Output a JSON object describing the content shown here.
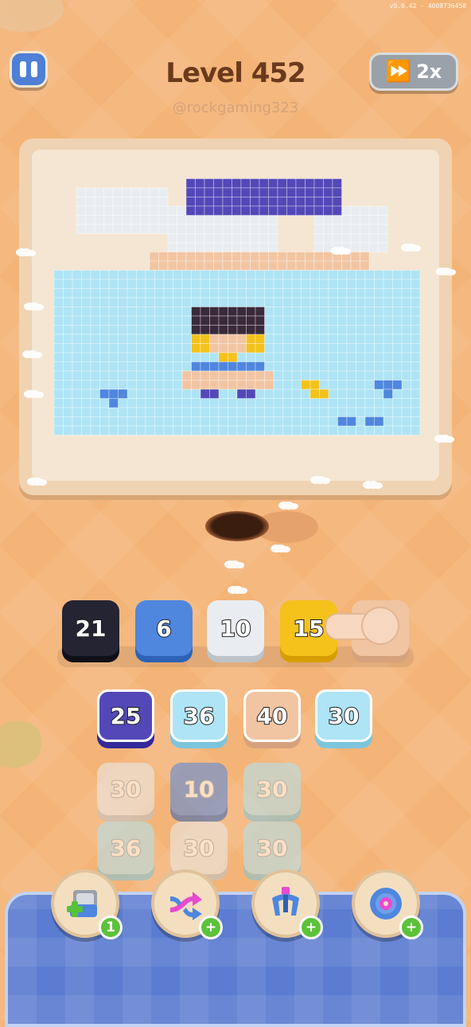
{
  "version_text": "v5.0.42 - 4008736458",
  "header": {
    "title": "Level 452",
    "watermark": "@rockgaming323",
    "speed_label": "2x"
  },
  "colors": {
    "navy": "#242432",
    "blue": "#4f86de",
    "white": "#e9edf1",
    "yellow": "#f5c21b",
    "peach": "#f2c5a2",
    "purple": "#5448b8",
    "light_blue": "#aee4f5",
    "dark_brown": "#3b2a3a"
  },
  "collector_slots": [
    {
      "count": "21",
      "color": "navy"
    },
    {
      "count": "6",
      "color": "blue"
    },
    {
      "count": "10",
      "color": "white"
    },
    {
      "count": "15",
      "color": "yellow"
    },
    {
      "count": "",
      "color": "peach"
    }
  ],
  "tile_grid": [
    {
      "count": "25",
      "color": "purple",
      "locked": false
    },
    {
      "count": "36",
      "color": "light_blue",
      "locked": false
    },
    {
      "count": "40",
      "color": "peach",
      "locked": false
    },
    {
      "count": "30",
      "color": "light_blue",
      "locked": false
    },
    {
      "count": "30",
      "color": "white",
      "locked": true
    },
    {
      "count": "10",
      "color": "blue",
      "locked": true
    },
    {
      "count": "30",
      "color": "light_blue",
      "locked": true
    },
    {
      "count": "36",
      "color": "light_blue",
      "locked": true
    },
    {
      "count": "30",
      "color": "white",
      "locked": true
    },
    {
      "count": "30",
      "color": "light_blue",
      "locked": true
    }
  ],
  "powerups": [
    {
      "name": "add-box",
      "icon": "box-plus-icon",
      "badge": "1"
    },
    {
      "name": "shuffle",
      "icon": "shuffle-arrows-icon",
      "badge": "+"
    },
    {
      "name": "magnet",
      "icon": "magnet-claw-icon",
      "badge": "+"
    },
    {
      "name": "donut",
      "icon": "donut-icon",
      "badge": "+"
    }
  ]
}
